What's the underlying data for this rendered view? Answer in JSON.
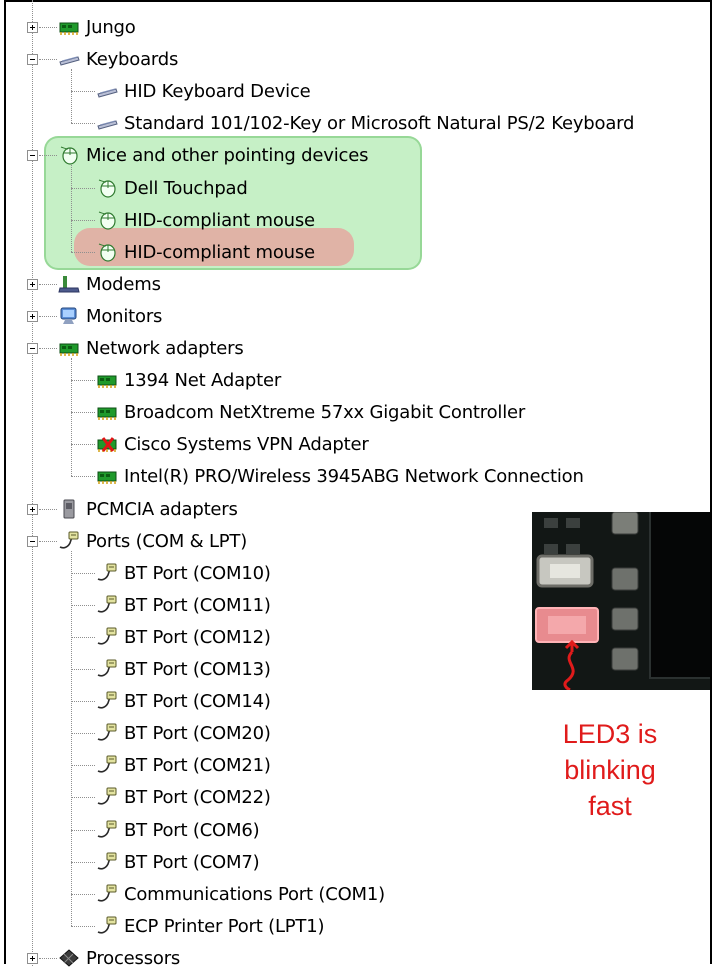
{
  "tree": [
    {
      "label": "Jungo",
      "icon": "network-card-icon",
      "level": 0,
      "expander": "plus"
    },
    {
      "label": "Keyboards",
      "icon": "keyboard-icon",
      "level": 0,
      "expander": "minus"
    },
    {
      "label": "HID Keyboard Device",
      "icon": "keyboard-icon",
      "level": 1
    },
    {
      "label": "Standard 101/102-Key or Microsoft Natural PS/2 Keyboard",
      "icon": "keyboard-icon",
      "level": 1
    },
    {
      "label": "Mice and other pointing devices",
      "icon": "mouse-icon",
      "level": 0,
      "expander": "minus"
    },
    {
      "label": "Dell Touchpad",
      "icon": "mouse-icon",
      "level": 1
    },
    {
      "label": "HID-compliant mouse",
      "icon": "mouse-icon",
      "level": 1
    },
    {
      "label": "HID-compliant mouse",
      "icon": "mouse-icon",
      "level": 1
    },
    {
      "label": "Modems",
      "icon": "modem-icon",
      "level": 0,
      "expander": "plus"
    },
    {
      "label": "Monitors",
      "icon": "monitor-icon",
      "level": 0,
      "expander": "plus"
    },
    {
      "label": "Network adapters",
      "icon": "network-card-icon",
      "level": 0,
      "expander": "minus"
    },
    {
      "label": "1394 Net Adapter",
      "icon": "network-card-icon",
      "level": 1
    },
    {
      "label": "Broadcom NetXtreme 57xx Gigabit Controller",
      "icon": "network-card-icon",
      "level": 1
    },
    {
      "label": "Cisco Systems VPN Adapter",
      "icon": "network-card-disabled-icon",
      "level": 1
    },
    {
      "label": "Intel(R) PRO/Wireless 3945ABG Network Connection",
      "icon": "network-card-icon",
      "level": 1
    },
    {
      "label": "PCMCIA adapters",
      "icon": "pcmcia-icon",
      "level": 0,
      "expander": "plus"
    },
    {
      "label": "Ports (COM & LPT)",
      "icon": "port-icon",
      "level": 0,
      "expander": "minus"
    },
    {
      "label": "BT Port (COM10)",
      "icon": "port-icon",
      "level": 1
    },
    {
      "label": "BT Port (COM11)",
      "icon": "port-icon",
      "level": 1
    },
    {
      "label": "BT Port (COM12)",
      "icon": "port-icon",
      "level": 1
    },
    {
      "label": "BT Port (COM13)",
      "icon": "port-icon",
      "level": 1
    },
    {
      "label": "BT Port (COM14)",
      "icon": "port-icon",
      "level": 1
    },
    {
      "label": "BT Port (COM20)",
      "icon": "port-icon",
      "level": 1
    },
    {
      "label": "BT Port (COM21)",
      "icon": "port-icon",
      "level": 1
    },
    {
      "label": "BT Port (COM22)",
      "icon": "port-icon",
      "level": 1
    },
    {
      "label": "BT Port (COM6)",
      "icon": "port-icon",
      "level": 1
    },
    {
      "label": "BT Port (COM7)",
      "icon": "port-icon",
      "level": 1
    },
    {
      "label": "Communications Port (COM1)",
      "icon": "port-icon",
      "level": 1
    },
    {
      "label": "ECP Printer Port (LPT1)",
      "icon": "port-icon",
      "level": 1
    },
    {
      "label": "Processors",
      "icon": "processor-icon",
      "level": 0,
      "expander": "plus"
    }
  ],
  "annotation": {
    "line1": "LED3 is",
    "line2": "blinking",
    "line3": "fast"
  },
  "colors": {
    "highlight_group": "#9ee39e",
    "highlight_item": "#f5828c",
    "annotation_text": "#e01b1b"
  }
}
